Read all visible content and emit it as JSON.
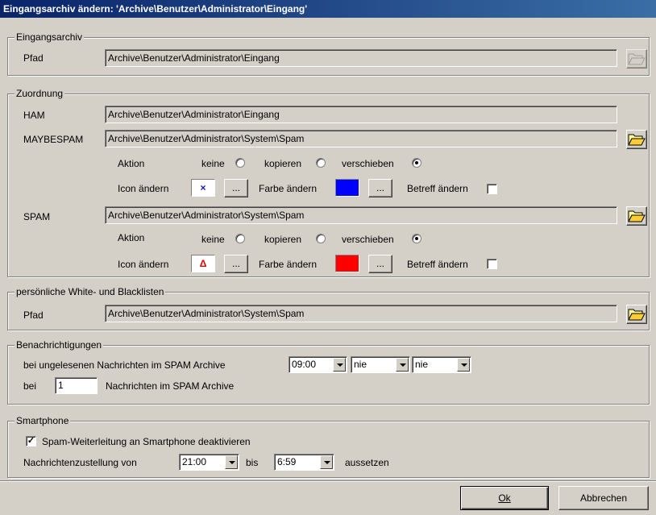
{
  "window": {
    "title": "Eingangsarchiv ändern: 'Archive\\Benutzer\\Administrator\\Eingang'"
  },
  "eingangsarchiv": {
    "legend": "Eingangsarchiv",
    "pfad_label": "Pfad",
    "pfad_value": "Archive\\Benutzer\\Administrator\\Eingang"
  },
  "zuordnung": {
    "legend": "Zuordnung",
    "ham_label": "HAM",
    "ham_value": "Archive\\Benutzer\\Administrator\\Eingang",
    "maybespam_label": "MAYBESPAM",
    "maybespam_value": "Archive\\Benutzer\\Administrator\\System\\Spam",
    "spam_label": "SPAM",
    "spam_value": "Archive\\Benutzer\\Administrator\\System\\Spam",
    "aktion_label": "Aktion",
    "keine_label": "keine",
    "kopieren_label": "kopieren",
    "verschieben_label": "verschieben",
    "icon_label": "Icon ändern",
    "farbe_label": "Farbe ändern",
    "betreff_label": "Betreff ändern",
    "ellipsis": "...",
    "maybespam_icon_glyph": "×",
    "spam_icon_glyph": "Δ",
    "maybespam_color": "#0000ff",
    "spam_color": "#ff0000",
    "maybespam_aktion": "verschieben",
    "spam_aktion": "verschieben"
  },
  "listen": {
    "legend": "persönliche White- und Blacklisten",
    "pfad_label": "Pfad",
    "pfad_value": "Archive\\Benutzer\\Administrator\\System\\Spam"
  },
  "benachrichtigungen": {
    "legend": "Benachrichtigungen",
    "line1_label": "bei ungelesenen Nachrichten im SPAM Archive",
    "time_value": "09:00",
    "combo2_value": "nie",
    "combo3_value": "nie",
    "bei_label": "bei",
    "count_value": "1",
    "line2_suffix": "Nachrichten im SPAM Archive"
  },
  "smartphone": {
    "legend": "Smartphone",
    "check_label": "Spam-Weiterleitung an Smartphone deaktivieren",
    "checked": true,
    "zustellung_label": "Nachrichtenzustellung von",
    "from_value": "21:00",
    "bis_label": "bis",
    "to_value": "6:59",
    "aussetzen_label": "aussetzen"
  },
  "buttons": {
    "ok_label": "Ok",
    "abbrechen_label": "Abbrechen"
  }
}
